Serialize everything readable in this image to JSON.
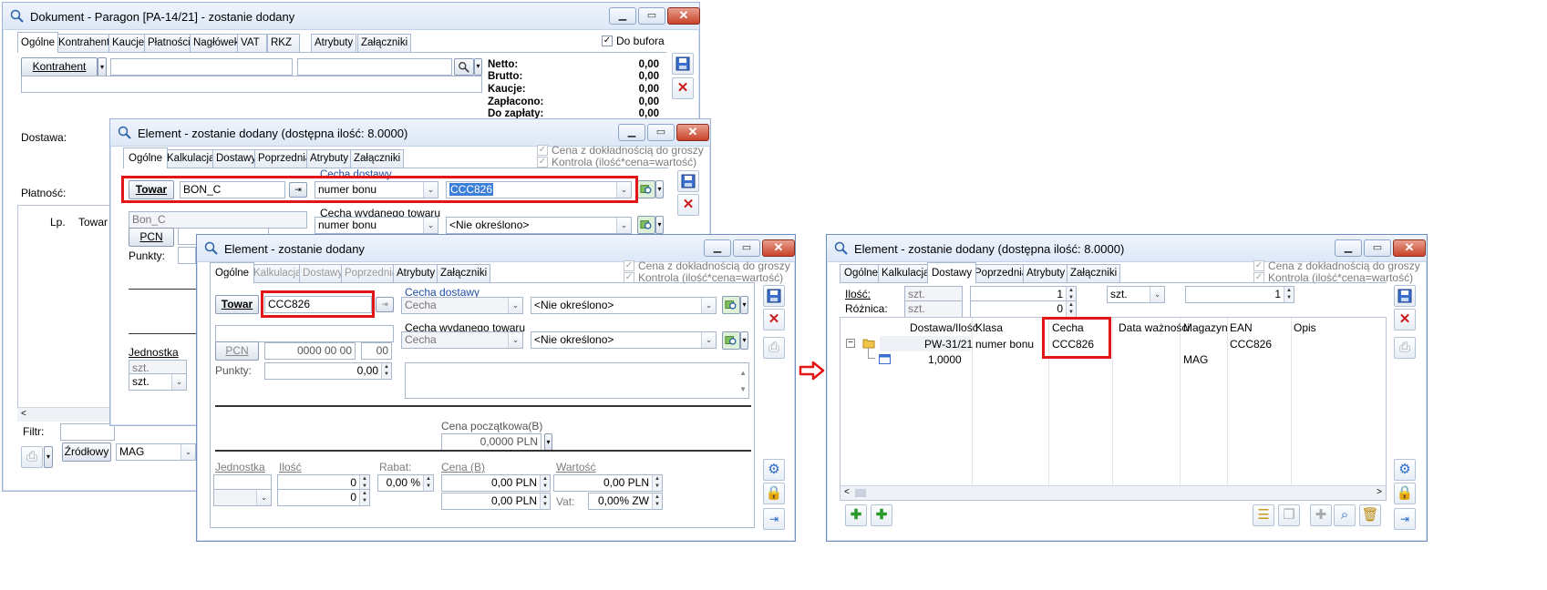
{
  "win1": {
    "title": "Dokument - Paragon [PA-14/21]  - zostanie dodany",
    "tabs": [
      "Ogólne",
      "Kontrahent",
      "Kaucje",
      "Płatności",
      "Nagłówek",
      "VAT",
      "RKZ",
      "Atrybuty",
      "Załączniki"
    ],
    "do_bufora": "Do bufora",
    "kontrahent_btn": "Kontrahent",
    "sums": [
      {
        "label": "Netto:",
        "value": "0,00"
      },
      {
        "label": "Brutto:",
        "value": "0,00"
      },
      {
        "label": "Kaucje:",
        "value": "0,00"
      },
      {
        "label": "Zapłacono:",
        "value": "0,00"
      },
      {
        "label": "Do zapłaty:",
        "value": "0,00"
      }
    ],
    "dostawa_label": "Dostawa:",
    "platnosc_label": "Płatność:",
    "col_lp": "Lp.",
    "col_towar": "Towar",
    "filtr_label": "Filtr:",
    "zrodlowy_btn": "Źródłowy",
    "magazyn": "MAG"
  },
  "win2": {
    "title": "Element - zostanie dodany (dostępna ilość: 8.0000)",
    "tabs": [
      "Ogólne",
      "Kalkulacja",
      "Dostawy",
      "Poprzednia",
      "Atrybuty",
      "Załączniki"
    ],
    "check1": "Cena z dokładnością do groszy",
    "check2": "Kontrola (ilość*cena=wartość)",
    "towar_btn": "Towar",
    "towar_code": "BON_C",
    "cecha_dostawy_label": "Cecha dostawy",
    "cecha_dostawy_class": "numer bonu",
    "cecha_dostawy_value": "CCC826",
    "name_value": "Bon_C",
    "pcn_btn": "PCN",
    "punkty_label": "Punkty:",
    "cecha_wydanego_label": "Cecha wydanego towaru",
    "cecha_wydanego_class": "numer bonu",
    "cecha_wydanego_value": "<Nie określono>",
    "jednostka_label": "Jednostka",
    "unit_ro": "szt.",
    "unit": "szt."
  },
  "win3": {
    "title": "Element - zostanie dodany",
    "tabs": [
      "Ogólne",
      "Kalkulacja",
      "Dostawy",
      "Poprzednia",
      "Atrybuty",
      "Załączniki"
    ],
    "check1": "Cena z dokładnością do groszy",
    "check2": "Kontrola (ilość*cena=wartość)",
    "towar_btn": "Towar",
    "towar_code": "CCC826",
    "cecha_dostawy_label": "Cecha dostawy",
    "cecha_dostawy_class": "Cecha",
    "cecha_dostawy_value": "<Nie określono>",
    "cecha_wydanego_label": "Cecha wydanego towaru",
    "cecha_wydanego_class": "Cecha",
    "cecha_wydanego_value": "<Nie określono>",
    "pcn_btn": "PCN",
    "pcn_value": "0000 00 00",
    "pcn_suffix": "00",
    "punkty_label": "Punkty:",
    "punkty_value": "0,00",
    "cena_pocz_label": "Cena początkowa(B)",
    "cena_pocz_value": "0,0000 PLN",
    "jednostka_label": "Jednostka",
    "ilosc_label": "Ilość",
    "rabat_label": "Rabat:",
    "cena_b_label": "Cena (B)",
    "wartosc_label": "Wartość",
    "vat_label": "Vat:",
    "ilosc1": "0",
    "ilosc2": "0",
    "rabat_value": "0,00 %",
    "cena1": "0,00 PLN",
    "cena2": "0,00 PLN",
    "wartosc1": "0,00 PLN",
    "vat_value": "0,00% ZW"
  },
  "win4": {
    "title": "Element - zostanie dodany (dostępna ilość: 8.0000)",
    "tabs": [
      "Ogólne",
      "Kalkulacja",
      "Dostawy",
      "Poprzednia",
      "Atrybuty",
      "Załączniki"
    ],
    "check1": "Cena z dokładnością do groszy",
    "check2": "Kontrola (ilość*cena=wartość)",
    "ilosc_label": "Ilość:",
    "roznica_label": "Różnica:",
    "unit_ro1": "szt.",
    "unit_ro2": "szt.",
    "ilosc_value": "1",
    "roznica_value": "0",
    "unit_select": "szt.",
    "ilosc_value2": "1",
    "columns": [
      "Dostawa/Ilość",
      "Klasa",
      "Cecha",
      "Data ważności",
      "Magazyn",
      "EAN",
      "Opis"
    ],
    "row1": {
      "dostawa": "PW-31/21",
      "klasa": "numer bonu",
      "cecha": "CCC826",
      "ean": "CCC826"
    },
    "row2": {
      "ilosc": "1,0000",
      "magazyn": "MAG"
    }
  },
  "colors": {
    "highlight_red": "#e21616",
    "title_blue": "#dde8f7",
    "arrow": "#e21616"
  }
}
